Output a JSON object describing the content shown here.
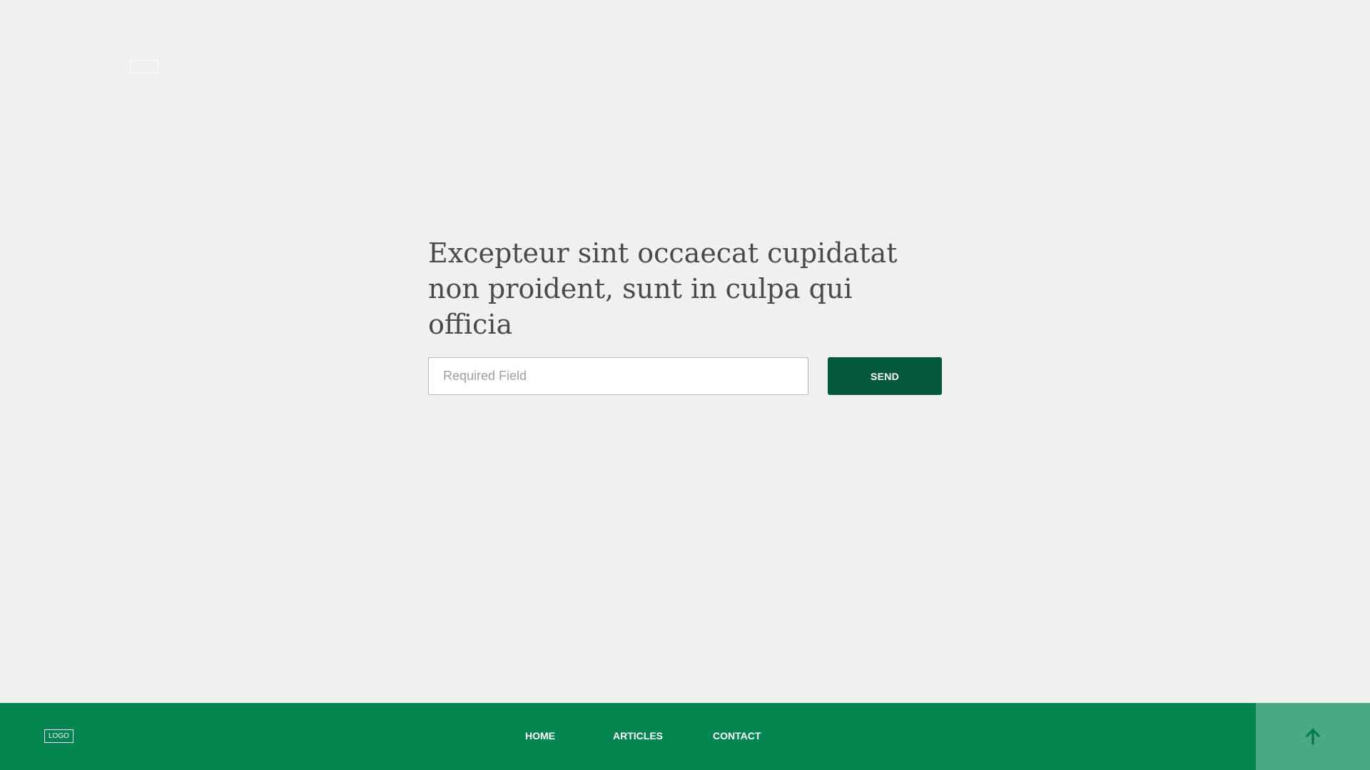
{
  "header": {
    "logo_placeholder": ""
  },
  "hero": {
    "headline": "Excepteur sint occaecat cupidatat non proident, sunt in culpa qui officia"
  },
  "form": {
    "input_placeholder": "Required Field",
    "input_value": "",
    "send_label": "SEND"
  },
  "footer": {
    "logo_text": "LOGO",
    "nav": {
      "home": "HOME",
      "articles": "ARTICLES",
      "contact": "CONTACT"
    },
    "back_to_top_icon": "arrow-up-icon"
  },
  "colors": {
    "background": "#f0f0f0",
    "button": "#035a3b",
    "footer": "#038552",
    "back_to_top": "#4aa883"
  }
}
